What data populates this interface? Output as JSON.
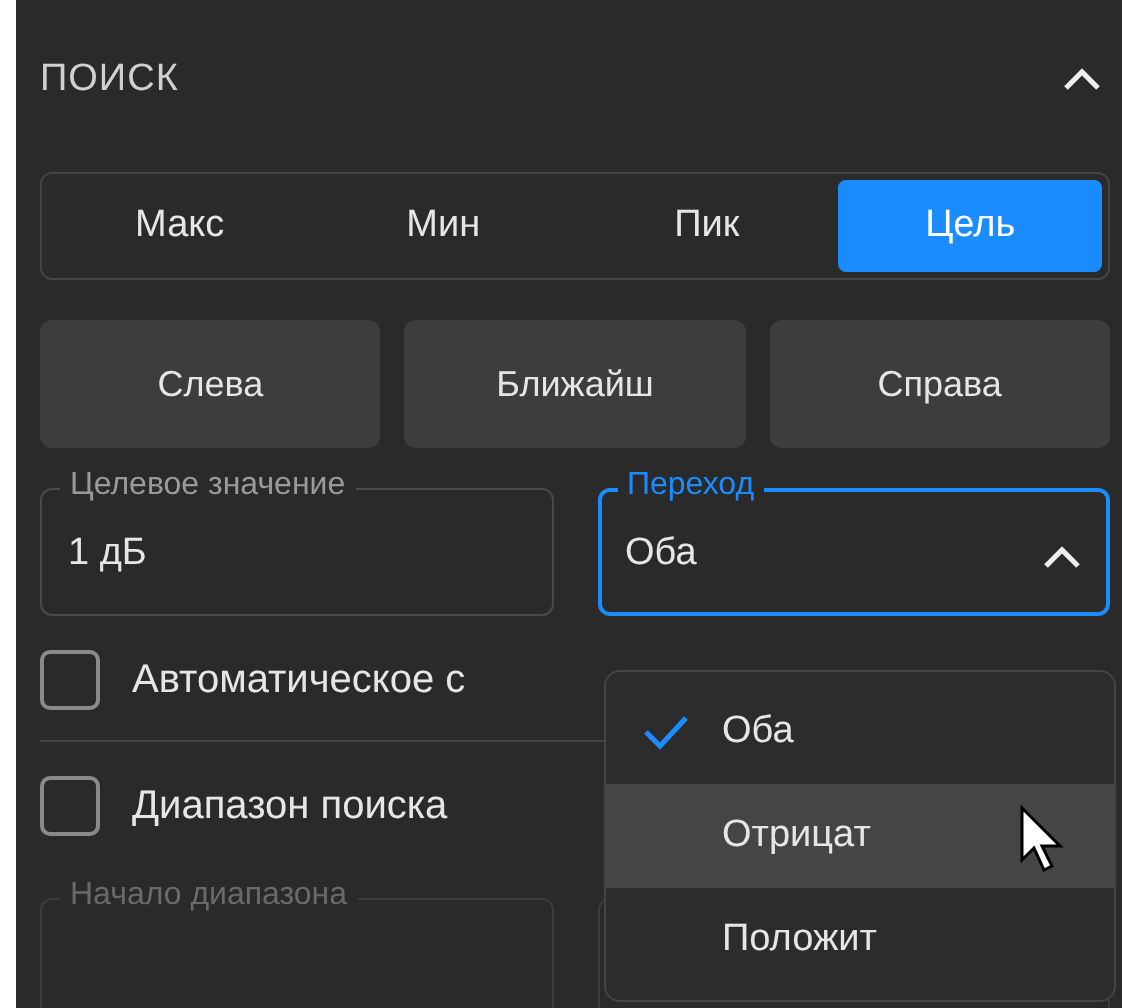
{
  "panel": {
    "title": "ПОИСК",
    "expanded": true
  },
  "search_type": [
    {
      "label": "Макс",
      "selected": false
    },
    {
      "label": "Мин",
      "selected": false
    },
    {
      "label": "Пик",
      "selected": false
    },
    {
      "label": "Цель",
      "selected": true
    }
  ],
  "direction_buttons": [
    "Слева",
    "Ближайш",
    "Справа"
  ],
  "target_value": {
    "label": "Целевое значение",
    "value": "1 дБ"
  },
  "transition": {
    "label": "Переход",
    "value": "Оба",
    "open": true
  },
  "transition_menu": [
    {
      "label": "Оба",
      "selected": true,
      "hovered": false
    },
    {
      "label": "Отрицат",
      "selected": false,
      "hovered": true
    },
    {
      "label": "Положит",
      "selected": false,
      "hovered": false
    }
  ],
  "checkboxes": [
    {
      "label": "Автоматическое с",
      "checked": false
    },
    {
      "label": "Диапазон поиска",
      "checked": false
    }
  ],
  "range_start": {
    "label": "Начало диапазона"
  }
}
